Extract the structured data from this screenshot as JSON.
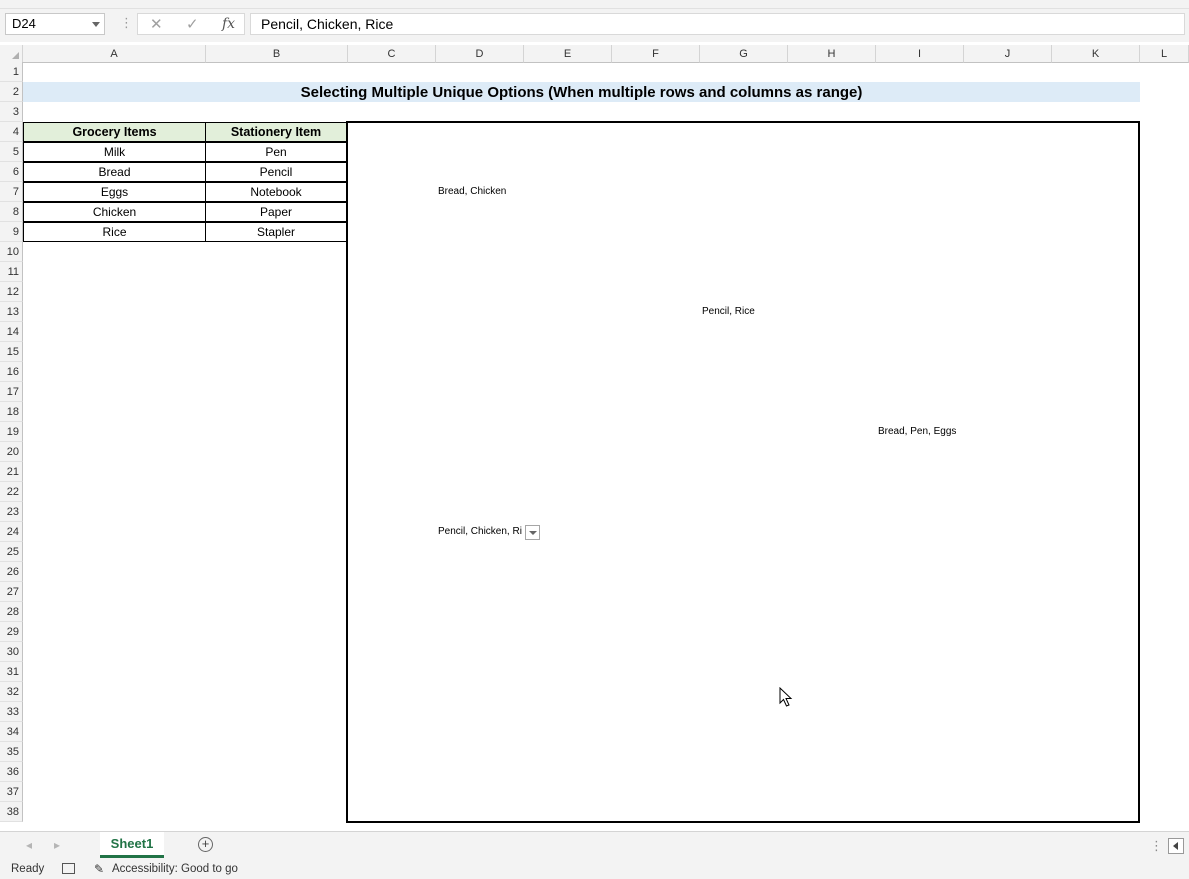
{
  "formula_bar": {
    "name_box": "D24",
    "separator": "⋮",
    "cancel_glyph": "✕",
    "enter_glyph": "✓",
    "fx_glyph": "fx",
    "formula": "Pencil, Chicken, Rice"
  },
  "columns": [
    "A",
    "B",
    "C",
    "D",
    "E",
    "F",
    "G",
    "H",
    "I",
    "J",
    "K",
    "L"
  ],
  "rows": [
    "1",
    "2",
    "3",
    "4",
    "5",
    "6",
    "7",
    "8",
    "9",
    "10",
    "11",
    "12",
    "13",
    "14",
    "15",
    "16",
    "17",
    "18",
    "19",
    "20",
    "21",
    "22",
    "23",
    "24",
    "25",
    "26",
    "27",
    "28",
    "29",
    "30",
    "31",
    "32",
    "33",
    "34",
    "35",
    "36",
    "37",
    "38"
  ],
  "sheet": {
    "title": "Selecting Multiple Unique Options (When multiple rows and columns as range)",
    "table": {
      "headers": [
        "Grocery Items",
        "Stationery Item"
      ],
      "rows": [
        [
          "Milk",
          "Pen"
        ],
        [
          "Bread",
          "Pencil"
        ],
        [
          "Eggs",
          "Notebook"
        ],
        [
          "Chicken",
          "Paper"
        ],
        [
          "Rice",
          "Stapler"
        ]
      ]
    },
    "dropdown_cells": {
      "d7": "Bread, Chicken",
      "g13": "Pencil, Rice",
      "i19": "Bread, Pen, Eggs",
      "d24": "Pencil, Chicken, Ri"
    },
    "title_band_color": "#ddebf7",
    "header_fill_color": "#e2efda"
  },
  "tabs": {
    "prev_glyph": "◂",
    "next_glyph": "▸",
    "active": "Sheet1",
    "add_glyph": "+",
    "more_glyph": "⋮"
  },
  "status": {
    "ready": "Ready",
    "accessibility": "Accessibility: Good to go",
    "accessibility_icon": "✎"
  },
  "accent_color": "#217346"
}
